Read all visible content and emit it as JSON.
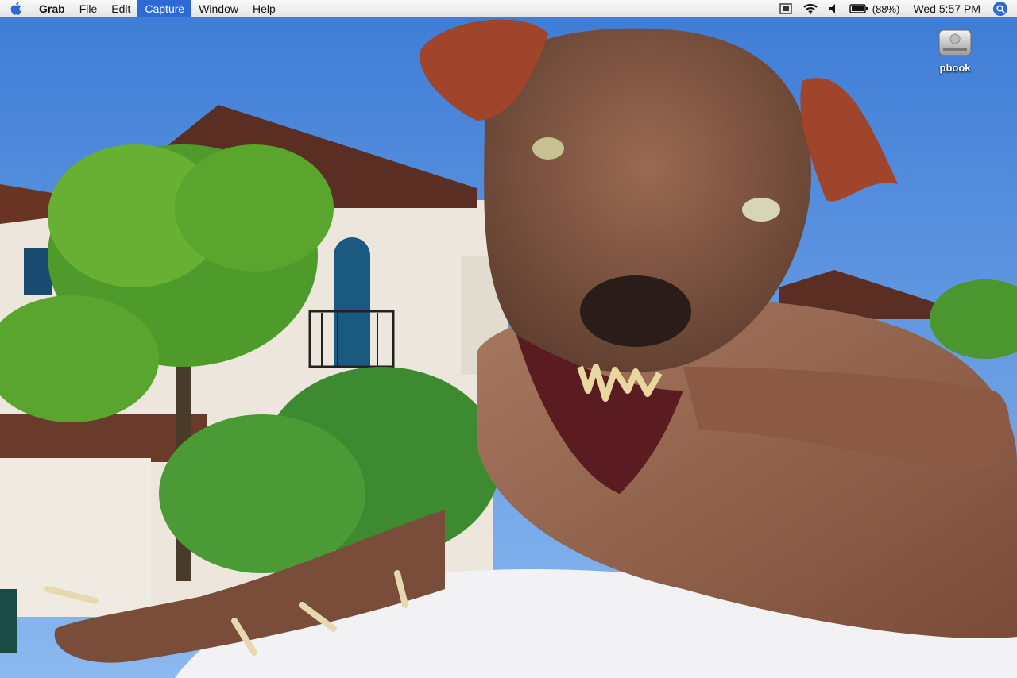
{
  "menubar": {
    "apple_icon": "apple-icon",
    "app_name": "Grab",
    "menus": [
      "File",
      "Edit",
      "Capture",
      "Window",
      "Help"
    ],
    "active_menu": "Capture",
    "battery_percent": "(88%)",
    "clock": "Wed 5:57 PM",
    "extras_icons": [
      "display-icon",
      "wifi-icon",
      "volume-icon",
      "battery-icon",
      "spotlight-icon"
    ]
  },
  "desktop": {
    "icons": [
      {
        "label": "pbook",
        "icon": "hard-drive-icon"
      }
    ],
    "wallpaper": "photo of hairless dog in front of white stucco building"
  },
  "colors": {
    "menu_highlight": "#2d6ad6",
    "sky": "#4f8ad8",
    "dog_skin": "#8a5a44"
  }
}
